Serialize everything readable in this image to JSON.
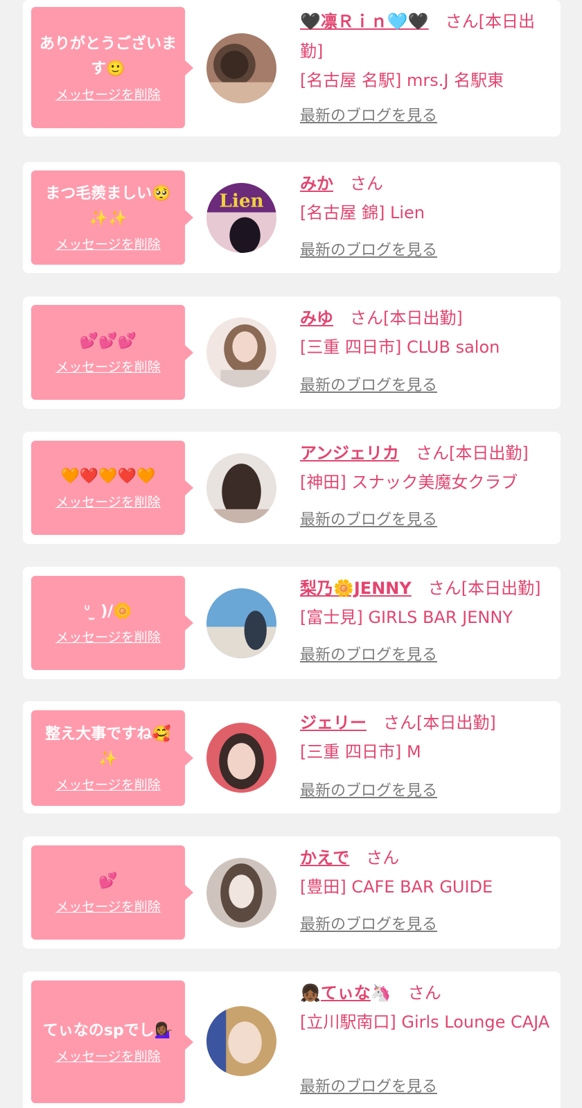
{
  "items": [
    {
      "message": "ありがとうございます🙂",
      "delete_label": "メッセージを削除",
      "name": "🖤⁣凛Ｒｉｎ🩵🖤",
      "suffix": "さん[本日出勤]",
      "shop": "[名古屋 名駅] mrs.J 名駅東",
      "blog_label": "最新のブログを見る",
      "avatar_colors": [
        "#a47c69",
        "#5b4337",
        "#d6b59f"
      ]
    },
    {
      "message": "まつ毛羨ましい🥺✨✨",
      "delete_label": "メッセージを削除",
      "name": "みか",
      "suffix": "さん",
      "shop": "[名古屋 錦] Lien",
      "blog_label": "最新のブログを見る",
      "avatar_colors": [
        "#6b2a7a",
        "#1c1420",
        "#e6c9d2"
      ]
    },
    {
      "message": "💕💕💕",
      "delete_label": "メッセージを削除",
      "name": "みゆ",
      "suffix": "さん[本日出勤]",
      "shop": "[三重 四日市] CLUB salon",
      "blog_label": "最新のブログを見る",
      "avatar_colors": [
        "#d8cfcb",
        "#8a6a55",
        "#f1e6e2"
      ]
    },
    {
      "message": "🧡❤️🧡❤️🧡",
      "delete_label": "メッセージを削除",
      "name": "アンジェリカ",
      "suffix": "さん[本日出勤]",
      "shop": "[神田] スナック美魔女クラブ",
      "blog_label": "最新のブログを見る",
      "avatar_colors": [
        "#e9e3df",
        "#3b2c27",
        "#c7b4ab"
      ]
    },
    {
      "message": "ᐡ ̫ )/🌼",
      "delete_label": "メッセージを削除",
      "name": "梨乃🌼JENNY",
      "suffix": "さん[本日出勤]",
      "shop": "[富士見] GIRLS BAR JENNY",
      "blog_label": "最新のブログを見る",
      "avatar_colors": [
        "#6aa6d6",
        "#e3dcd3",
        "#2f3a4a"
      ]
    },
    {
      "message": "整え大事ですね🥰✨",
      "delete_label": "メッセージを削除",
      "name": "ジェリー",
      "suffix": "さん[本日出勤]",
      "shop": "[三重 四日市] M",
      "blog_label": "最新のブログを見る",
      "avatar_colors": [
        "#e0606a",
        "#3a2a28",
        "#f2d3c8"
      ]
    },
    {
      "message": "💕",
      "delete_label": "メッセージを削除",
      "name": "かえで",
      "suffix": "さん",
      "shop": "[豊田] CAFE BAR GUIDE",
      "blog_label": "最新のブログを見る",
      "avatar_colors": [
        "#cfc4bd",
        "#5c4a40",
        "#f0e5df"
      ]
    },
    {
      "message": "てぃなのspでし💁🏾‍♀️",
      "delete_label": "メッセージを削除",
      "name": "てぃな",
      "name_prefix": "👧🏾",
      "name_suffix": "🦄",
      "suffix": "さん",
      "shop": "[立川駅南口] Girls Lounge CAJA",
      "blog_label": "最新のブログを見る",
      "avatar_colors": [
        "#c9a36e",
        "#3c55a0",
        "#f1dccd"
      ]
    }
  ]
}
